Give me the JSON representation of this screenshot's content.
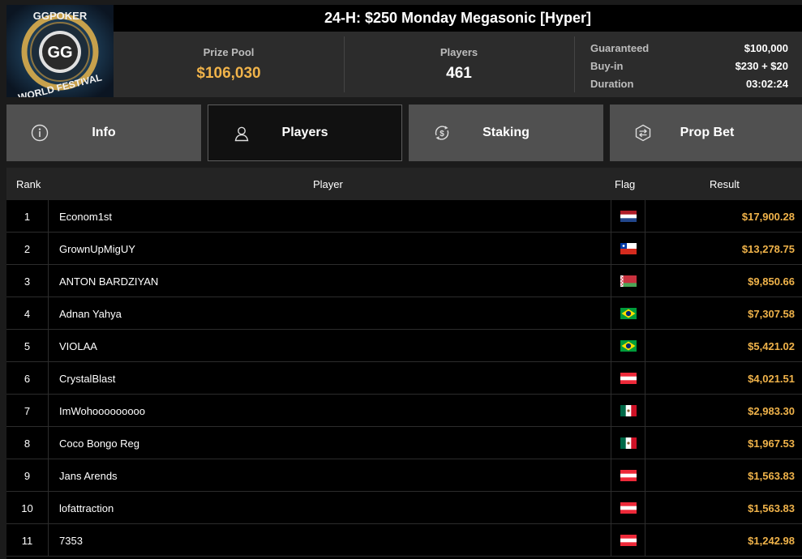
{
  "logo": {
    "top_text": "GGPOKER",
    "center_text": "GG",
    "bottom_text": "WORLD FESTIVAL"
  },
  "tournament": {
    "title": "24-H: $250 Monday Megasonic [Hyper]"
  },
  "stats": {
    "prize_pool_label": "Prize Pool",
    "prize_pool_value": "$106,030",
    "players_label": "Players",
    "players_value": "461",
    "details": [
      {
        "label": "Guaranteed",
        "value": "$100,000"
      },
      {
        "label": "Buy-in",
        "value": "$230 + $20"
      },
      {
        "label": "Duration",
        "value": "03:02:24"
      }
    ]
  },
  "tabs": [
    {
      "label": "Info",
      "icon": "info-icon"
    },
    {
      "label": "Players",
      "icon": "user-icon",
      "active": true
    },
    {
      "label": "Staking",
      "icon": "dollar-cycle-icon"
    },
    {
      "label": "Prop Bet",
      "icon": "prop-bet-icon"
    }
  ],
  "table": {
    "headers": {
      "rank": "Rank",
      "player": "Player",
      "flag": "Flag",
      "result": "Result"
    },
    "rows": [
      {
        "rank": "1",
        "player": "Econom1st",
        "flag": "netherlands-flag",
        "result": "$17,900.28"
      },
      {
        "rank": "2",
        "player": "GrownUpMigUY",
        "flag": "chile-flag",
        "result": "$13,278.75"
      },
      {
        "rank": "3",
        "player": "ANTON BARDZIYAN",
        "flag": "belarus-flag",
        "result": "$9,850.66"
      },
      {
        "rank": "4",
        "player": "Adnan Yahya",
        "flag": "brazil-flag",
        "result": "$7,307.58"
      },
      {
        "rank": "5",
        "player": "VIOLAA",
        "flag": "brazil-flag",
        "result": "$5,421.02"
      },
      {
        "rank": "6",
        "player": "CrystalBlast",
        "flag": "austria-flag",
        "result": "$4,021.51"
      },
      {
        "rank": "7",
        "player": "ImWohooooooooo",
        "flag": "mexico-flag",
        "result": "$2,983.30"
      },
      {
        "rank": "8",
        "player": "Coco Bongo Reg",
        "flag": "mexico-flag",
        "result": "$1,967.53"
      },
      {
        "rank": "9",
        "player": "Jans Arends",
        "flag": "austria-flag",
        "result": "$1,563.83"
      },
      {
        "rank": "10",
        "player": "lofattraction",
        "flag": "austria-flag",
        "result": "$1,563.83"
      },
      {
        "rank": "11",
        "player": "7353",
        "flag": "austria-flag",
        "result": "$1,242.98"
      }
    ]
  },
  "colors": {
    "accent": "#f0b34a",
    "active_tab": "#111111",
    "tab": "#505050"
  }
}
